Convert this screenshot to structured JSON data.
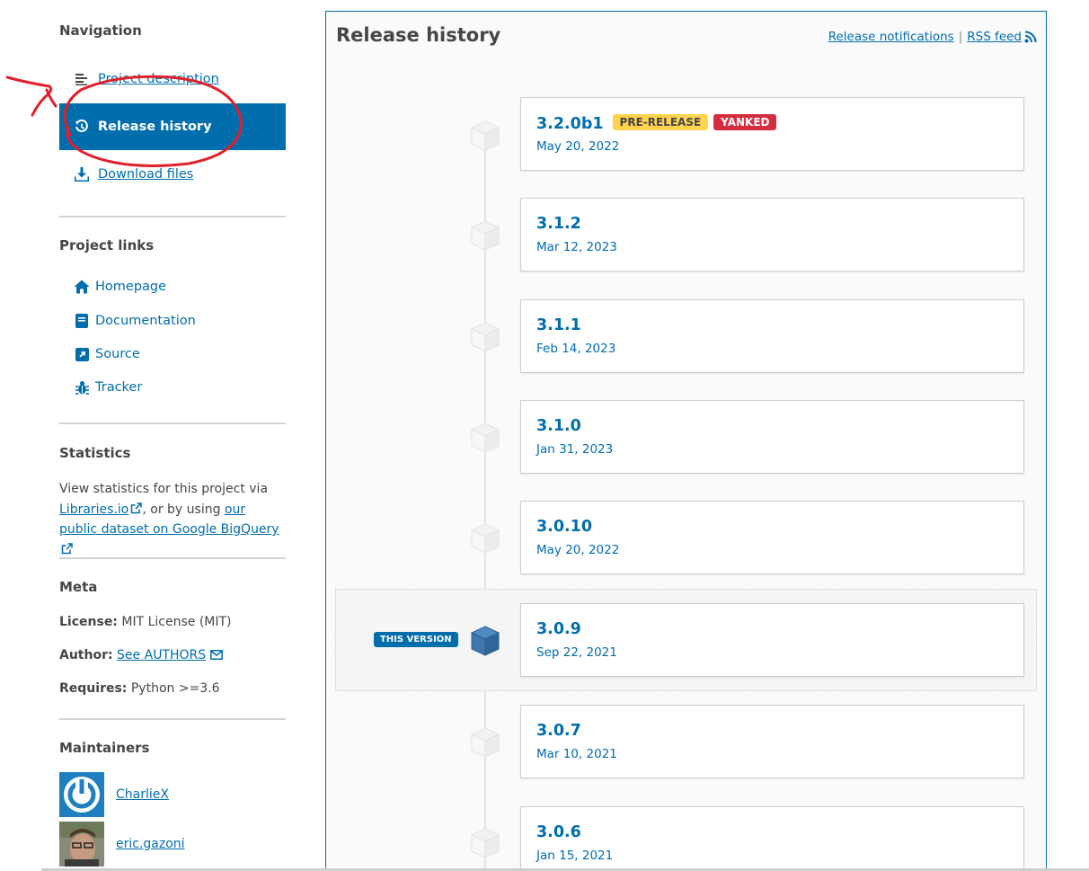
{
  "sidebar": {
    "navigation_heading": "Navigation",
    "nav": [
      {
        "label": "Project description",
        "icon": "align-left-icon"
      },
      {
        "label": "Release history",
        "icon": "history-icon",
        "active": true
      },
      {
        "label": "Download files",
        "icon": "download-icon"
      }
    ],
    "project_links_heading": "Project links",
    "project_links": [
      {
        "label": "Homepage",
        "icon": "home-icon"
      },
      {
        "label": "Documentation",
        "icon": "book-icon"
      },
      {
        "label": "Source",
        "icon": "external-link-square-icon"
      },
      {
        "label": "Tracker",
        "icon": "bug-icon"
      }
    ],
    "statistics_heading": "Statistics",
    "statistics": {
      "text_before": "View statistics for this project via",
      "libraries_link": "Libraries.io",
      "text_middle": ", or by using",
      "bigquery_link": "our public dataset on Google BigQuery"
    },
    "meta_heading": "Meta",
    "meta": {
      "license_label": "License:",
      "license_value": "MIT License (MIT)",
      "author_label": "Author:",
      "author_link": "See AUTHORS",
      "requires_label": "Requires:",
      "requires_value": "Python >=3.6"
    },
    "maintainers_heading": "Maintainers",
    "maintainers": [
      {
        "name": "CharlieX",
        "avatar": "power-button-avatar"
      },
      {
        "name": "eric.gazoni",
        "avatar": "photo-avatar"
      }
    ]
  },
  "main": {
    "title": "Release history",
    "release_notifications_link": "Release notifications",
    "separator": "|",
    "rss_feed_link": "RSS feed",
    "this_version_label": "THIS VERSION",
    "releases": [
      {
        "version": "3.2.0b1",
        "date": "May 20, 2022",
        "badges": [
          "PRE-RELEASE",
          "YANKED"
        ]
      },
      {
        "version": "3.1.2",
        "date": "Mar 12, 2023"
      },
      {
        "version": "3.1.1",
        "date": "Feb 14, 2023"
      },
      {
        "version": "3.1.0",
        "date": "Jan 31, 2023"
      },
      {
        "version": "3.0.10",
        "date": "May 20, 2022"
      },
      {
        "version": "3.0.9",
        "date": "Sep 22, 2021",
        "current": true
      },
      {
        "version": "3.0.7",
        "date": "Mar 10, 2021"
      },
      {
        "version": "3.0.6",
        "date": "Jan 15, 2021"
      }
    ]
  },
  "colors": {
    "link_blue": "#006dad",
    "prerelease_yellow": "#ffd34e",
    "yanked_red": "#d52d40",
    "annotation_red": "#e0202a"
  }
}
